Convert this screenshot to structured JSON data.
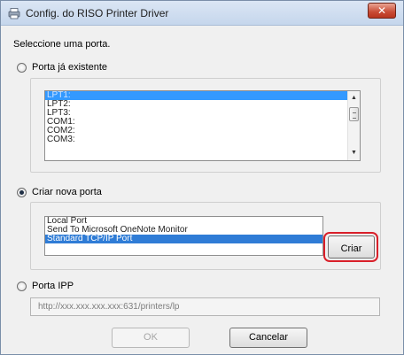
{
  "window": {
    "title": "Config. do RISO Printer Driver",
    "close_label": "✕"
  },
  "prompt": "Seleccione uma porta.",
  "existing_port": {
    "label": "Porta já existente",
    "selected": false,
    "items": [
      "LPT1:",
      "LPT2:",
      "LPT3:",
      "COM1:",
      "COM2:",
      "COM3:"
    ],
    "selected_item": "LPT1:"
  },
  "new_port": {
    "label": "Criar nova porta",
    "selected": true,
    "items": [
      "Local Port",
      "Send To Microsoft OneNote Monitor",
      "Standard TCP/IP Port"
    ],
    "selected_item": "Standard TCP/IP Port",
    "create_label": "Criar"
  },
  "ipp_port": {
    "label": "Porta IPP",
    "selected": false,
    "placeholder": "http://xxx.xxx.xxx.xxx:631/printers/lp"
  },
  "footer": {
    "ok_label": "OK",
    "cancel_label": "Cancelar"
  },
  "colors": {
    "selection": "#3399ff",
    "highlight_ring": "#d9202a",
    "close_button": "#c84a34"
  }
}
